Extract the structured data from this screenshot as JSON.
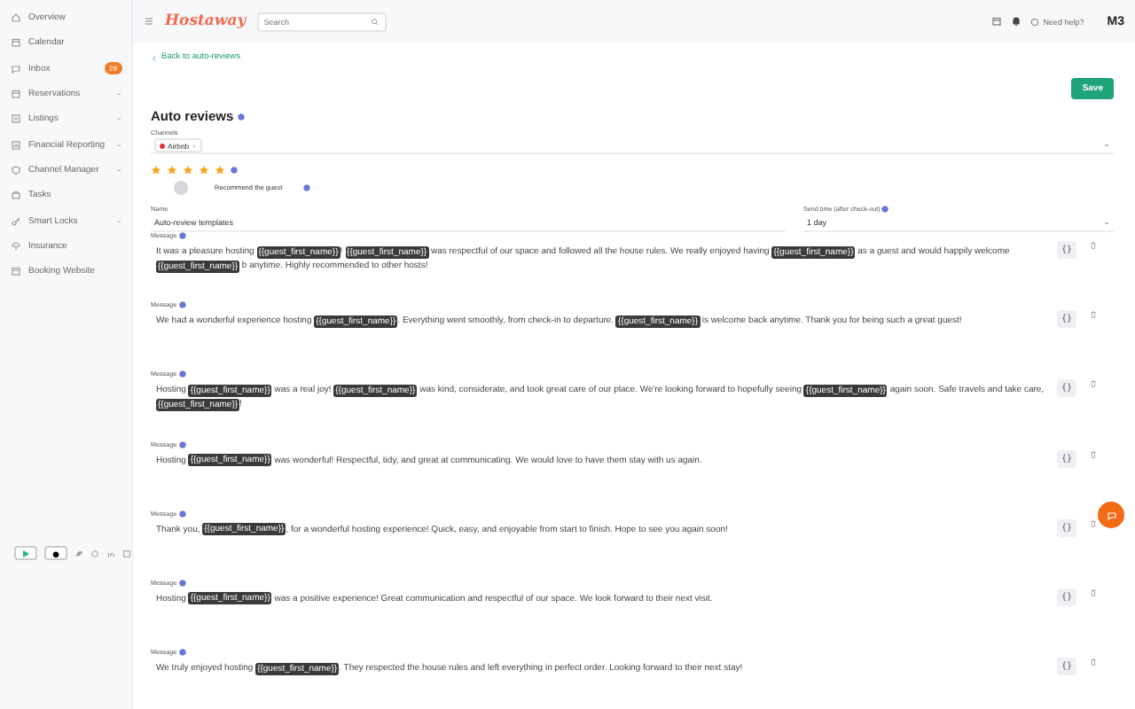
{
  "sidebar": {
    "items": [
      {
        "label": "Overview",
        "expandable": false
      },
      {
        "label": "Calendar",
        "expandable": false
      },
      {
        "label": "Inbox",
        "expandable": false,
        "badge": "29"
      },
      {
        "label": "Reservations",
        "expandable": true
      },
      {
        "label": "Listings",
        "expandable": true
      },
      {
        "label": "Financial Reporting",
        "expandable": true
      },
      {
        "label": "Channel Manager",
        "expandable": true
      },
      {
        "label": "Tasks",
        "expandable": false
      },
      {
        "label": "Smart Locks",
        "expandable": true
      },
      {
        "label": "Insurance",
        "expandable": false
      },
      {
        "label": "Booking Website",
        "expandable": false
      }
    ]
  },
  "header": {
    "logo": "Hostaway",
    "search": {
      "placeholder": "Search"
    },
    "help": "Need help?",
    "account": "M3"
  },
  "back_link": "Back to auto-reviews",
  "save_button": "Save",
  "variable_button": "{}",
  "title": "Auto reviews",
  "channels": {
    "label": "Channels",
    "tags": [
      {
        "label": "Airbnb",
        "color": "#e8323c"
      }
    ]
  },
  "rating": {
    "stars": 5
  },
  "recommend": {
    "label": "Recommend the guest",
    "on": false
  },
  "name": {
    "label": "Name",
    "value": "Auto-review templates"
  },
  "send_time": {
    "label": "Send time (after check-out)",
    "value": "1 day"
  },
  "messages": [
    {
      "label": "Message",
      "parts": [
        {
          "kind": "text",
          "text": "It was a pleasure hosting "
        },
        {
          "kind": "variable",
          "text": "{{guest_first_name}}"
        },
        {
          "kind": "text",
          "text": "! "
        },
        {
          "kind": "variable",
          "text": "{{guest_first_name}}"
        },
        {
          "kind": "text",
          "text": " was respectful of our space and followed all the house rules. We really enjoyed having "
        },
        {
          "kind": "variable",
          "text": "{{guest_first_name}}"
        },
        {
          "kind": "text",
          "text": " as a guest and would happily welcome "
        },
        {
          "kind": "variable",
          "text": "{{guest_first_name}}"
        },
        {
          "kind": "text",
          "text": " b anytime. Highly recommended to other hosts!"
        }
      ]
    },
    {
      "label": "Message",
      "parts": [
        {
          "kind": "text",
          "text": "We had a wonderful experience hosting "
        },
        {
          "kind": "variable",
          "text": "{{guest_first_name}}"
        },
        {
          "kind": "text",
          "text": ". Everything went smoothly, from check-in to departure. "
        },
        {
          "kind": "variable",
          "text": "{{guest_first_name}}"
        },
        {
          "kind": "text",
          "text": " is welcome back anytime. Thank you for being such a great guest!"
        }
      ]
    },
    {
      "label": "Message",
      "parts": [
        {
          "kind": "text",
          "text": "Hosting "
        },
        {
          "kind": "variable",
          "text": "{{guest_first_name}}"
        },
        {
          "kind": "text",
          "text": " was a real joy! "
        },
        {
          "kind": "variable",
          "text": "{{guest_first_name}}"
        },
        {
          "kind": "text",
          "text": " was kind, considerate, and took great care of our place. We're looking forward to hopefully seeing "
        },
        {
          "kind": "variable",
          "text": "{{guest_first_name}}"
        },
        {
          "kind": "text",
          "text": " again soon. Safe travels and take care, "
        },
        {
          "kind": "variable",
          "text": "{{guest_first_name}}"
        },
        {
          "kind": "text",
          "text": "!"
        }
      ]
    },
    {
      "label": "Message",
      "parts": [
        {
          "kind": "text",
          "text": "Hosting "
        },
        {
          "kind": "variable",
          "text": "{{guest_first_name}}"
        },
        {
          "kind": "text",
          "text": " was wonderful! Respectful, tidy, and great at communicating. We would love to have them stay with us again."
        }
      ]
    },
    {
      "label": "Message",
      "parts": [
        {
          "kind": "text",
          "text": "Thank you, "
        },
        {
          "kind": "variable",
          "text": "{{guest_first_name}}"
        },
        {
          "kind": "text",
          "text": ", for a wonderful hosting experience! Quick, easy, and enjoyable from start to finish. Hope to see you again soon!"
        }
      ]
    },
    {
      "label": "Message",
      "parts": [
        {
          "kind": "text",
          "text": "Hosting "
        },
        {
          "kind": "variable",
          "text": "{{guest_first_name}}"
        },
        {
          "kind": "text",
          "text": " was a positive experience! Great communication and respectful of our space. We look forward to their next visit."
        }
      ]
    },
    {
      "label": "Message",
      "parts": [
        {
          "kind": "text",
          "text": "We truly enjoyed hosting "
        },
        {
          "kind": "variable",
          "text": "{{guest_first_name}}"
        },
        {
          "kind": "text",
          "text": ". They respected the house rules and left everything in perfect order. Looking forward to their next stay!"
        }
      ]
    }
  ]
}
